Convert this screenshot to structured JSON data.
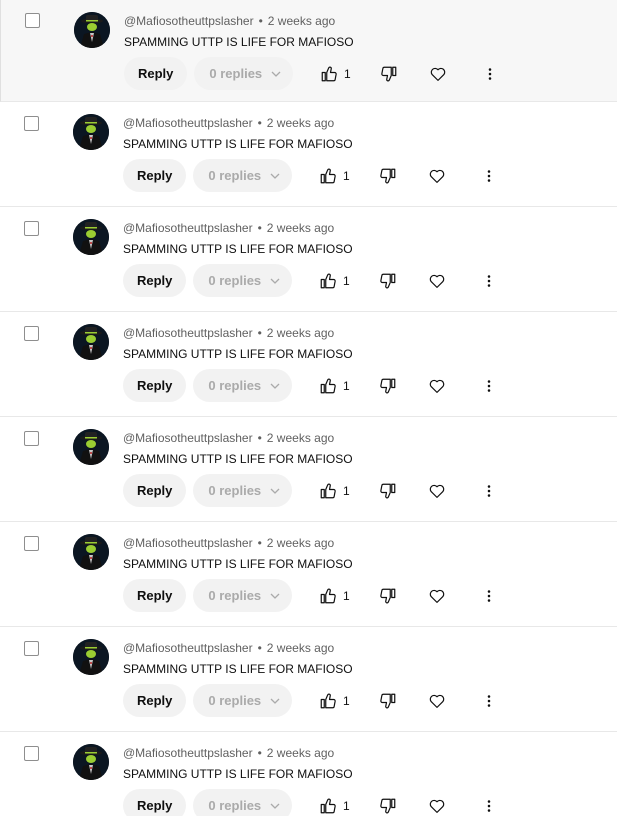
{
  "colors": {
    "pill_bg": "#f2f2f2",
    "meta_text": "#606060",
    "disabled_text": "#aaaaaa",
    "avatar_bg": "#0b1622",
    "avatar_accent": "#9acd32"
  },
  "icons": {
    "like": "thumb-up-icon",
    "dislike": "thumb-down-icon",
    "heart": "heart-icon",
    "more": "more-vert-icon",
    "chevron": "chevron-down-icon"
  },
  "comments": [
    {
      "author": "@Mafiosotheuttpslasher",
      "separator": "•",
      "time": "2 weeks ago",
      "text": "SPAMMING UTTP IS LIFE FOR MAFIOSO",
      "reply_label": "Reply",
      "replies_label": "0 replies",
      "likes": "1"
    },
    {
      "author": "@Mafiosotheuttpslasher",
      "separator": "•",
      "time": "2 weeks ago",
      "text": "SPAMMING UTTP IS LIFE FOR MAFIOSO",
      "reply_label": "Reply",
      "replies_label": "0 replies",
      "likes": "1"
    },
    {
      "author": "@Mafiosotheuttpslasher",
      "separator": "•",
      "time": "2 weeks ago",
      "text": "SPAMMING UTTP IS LIFE FOR MAFIOSO",
      "reply_label": "Reply",
      "replies_label": "0 replies",
      "likes": "1"
    },
    {
      "author": "@Mafiosotheuttpslasher",
      "separator": "•",
      "time": "2 weeks ago",
      "text": "SPAMMING UTTP IS LIFE FOR MAFIOSO",
      "reply_label": "Reply",
      "replies_label": "0 replies",
      "likes": "1"
    },
    {
      "author": "@Mafiosotheuttpslasher",
      "separator": "•",
      "time": "2 weeks ago",
      "text": "SPAMMING UTTP IS LIFE FOR MAFIOSO",
      "reply_label": "Reply",
      "replies_label": "0 replies",
      "likes": "1"
    },
    {
      "author": "@Mafiosotheuttpslasher",
      "separator": "•",
      "time": "2 weeks ago",
      "text": "SPAMMING UTTP IS LIFE FOR MAFIOSO",
      "reply_label": "Reply",
      "replies_label": "0 replies",
      "likes": "1"
    },
    {
      "author": "@Mafiosotheuttpslasher",
      "separator": "•",
      "time": "2 weeks ago",
      "text": "SPAMMING UTTP IS LIFE FOR MAFIOSO",
      "reply_label": "Reply",
      "replies_label": "0 replies",
      "likes": "1"
    },
    {
      "author": "@Mafiosotheuttpslasher",
      "separator": "•",
      "time": "2 weeks ago",
      "text": "SPAMMING UTTP IS LIFE FOR MAFIOSO",
      "reply_label": "Reply",
      "replies_label": "0 replies",
      "likes": "1"
    }
  ]
}
